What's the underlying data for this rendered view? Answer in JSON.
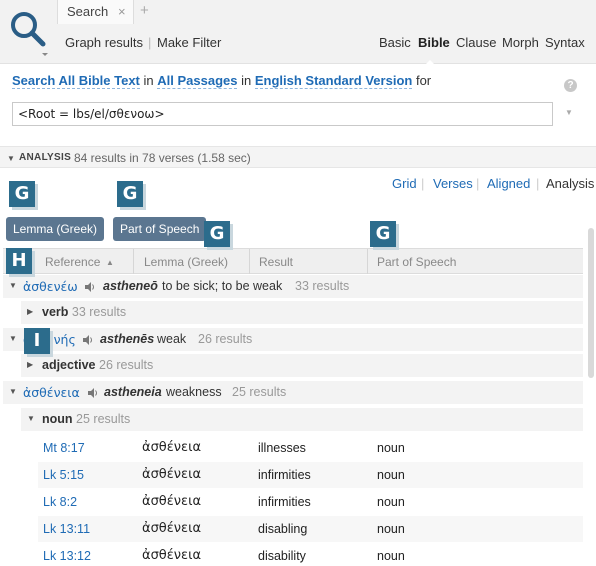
{
  "tab": {
    "label": "Search",
    "close": "×",
    "add": "+"
  },
  "toolbar": {
    "graph_results": "Graph results",
    "sep": "|",
    "make_filter": "Make Filter",
    "modes": [
      "Basic",
      "Bible",
      "Clause",
      "Morph",
      "Syntax"
    ],
    "selected_mode": "Bible"
  },
  "query": {
    "search_all": "Search All Bible Text",
    "in1": "in",
    "passages": "All Passages",
    "in2": "in",
    "version": "English Standard Version",
    "for": "for",
    "text": "<Root = lbs/el/σθενοω>",
    "help": "?"
  },
  "analysis": {
    "title": "ANALYSIS",
    "summary": "84 results in 78 verses (1.58 sec)"
  },
  "views": {
    "grid": "Grid",
    "verses": "Verses",
    "aligned": "Aligned",
    "analysis": "Analysis",
    "sep": "|"
  },
  "markers": {
    "g": "G",
    "h": "H",
    "i": "I"
  },
  "pills": {
    "lemma": "Lemma (Greek)",
    "pos": "Part of Speech"
  },
  "columns": {
    "reference": "Reference",
    "lemma": "Lemma (Greek)",
    "result": "Result",
    "pos": "Part of Speech"
  },
  "groups": [
    {
      "lemma": "ἀσθενέω",
      "translit": "astheneō",
      "gloss": "to be sick; to be weak",
      "count": "33 results",
      "sub": {
        "name": "verb",
        "count": "33 results"
      }
    },
    {
      "lemma": "ἀσθενής",
      "translit": "asthenēs",
      "gloss": "weak",
      "count": "26 results",
      "sub": {
        "name": "adjective",
        "count": "26 results"
      }
    },
    {
      "lemma": "ἀσθένεια",
      "translit": "astheneia",
      "gloss": "weakness",
      "count": "25 results",
      "sub": {
        "name": "noun",
        "count": "25 results"
      }
    }
  ],
  "rows": [
    {
      "ref": "Mt 8:17",
      "greek": "ἀσθένεια",
      "result": "illnesses",
      "pos": "noun"
    },
    {
      "ref": "Lk 5:15",
      "greek": "ἀσθένεια",
      "result": "infirmities",
      "pos": "noun"
    },
    {
      "ref": "Lk 8:2",
      "greek": "ἀσθένεια",
      "result": "infirmities",
      "pos": "noun"
    },
    {
      "ref": "Lk 13:11",
      "greek": "ἀσθένεια",
      "result": "disabling",
      "pos": "noun"
    },
    {
      "ref": "Lk 13:12",
      "greek": "ἀσθένεια",
      "result": "disability",
      "pos": "noun"
    }
  ],
  "colors": {
    "link": "#1f6bb5",
    "marker": "#2c6c8c",
    "pill": "#5b7690"
  },
  "icons": [
    "search-icon",
    "speaker-icon",
    "help-icon",
    "sort-arrow-icon",
    "expand-arrow-icon"
  ]
}
